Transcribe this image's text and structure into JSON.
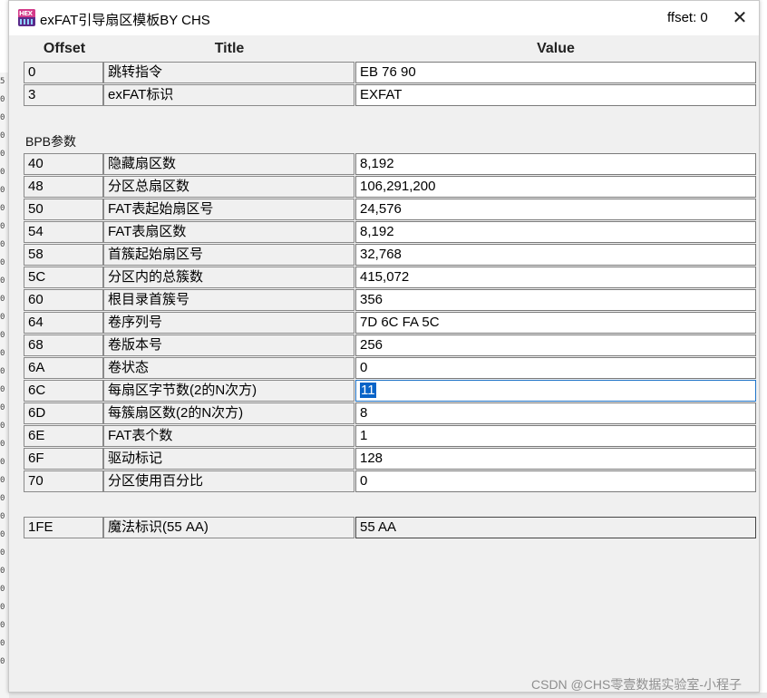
{
  "window": {
    "title": "exFAT引导扇区模板BY CHS",
    "offset_indicator": "ffset: 0",
    "close_glyph": "✕"
  },
  "columns": {
    "offset": "Offset",
    "title": "Title",
    "value": "Value"
  },
  "boot_rows": [
    {
      "offset": "0",
      "title": "跳转指令",
      "value": "EB 76 90"
    },
    {
      "offset": "3",
      "title": "exFAT标识",
      "value": "EXFAT"
    }
  ],
  "bpb_section_label": "BPB参数",
  "bpb_rows": [
    {
      "offset": "40",
      "title": "隐藏扇区数",
      "value": "8,192"
    },
    {
      "offset": "48",
      "title": "分区总扇区数",
      "value": "106,291,200"
    },
    {
      "offset": "50",
      "title": "FAT表起始扇区号",
      "value": "24,576"
    },
    {
      "offset": "54",
      "title": "FAT表扇区数",
      "value": "8,192"
    },
    {
      "offset": "58",
      "title": "首簇起始扇区号",
      "value": "32,768"
    },
    {
      "offset": "5C",
      "title": "分区内的总簇数",
      "value": "415,072"
    },
    {
      "offset": "60",
      "title": "根目录首簇号",
      "value": "356"
    },
    {
      "offset": "64",
      "title": "卷序列号",
      "value": "7D 6C FA 5C"
    },
    {
      "offset": "68",
      "title": "卷版本号",
      "value": "256"
    },
    {
      "offset": "6A",
      "title": "卷状态",
      "value": "0"
    },
    {
      "offset": "6C",
      "title": "每扇区字节数(2的N次方)",
      "value": "11",
      "selected": true
    },
    {
      "offset": "6D",
      "title": "每簇扇区数(2的N次方)",
      "value": "8"
    },
    {
      "offset": "6E",
      "title": "FAT表个数",
      "value": "1"
    },
    {
      "offset": "6F",
      "title": "驱动标记",
      "value": "128"
    },
    {
      "offset": "70",
      "title": "分区使用百分比",
      "value": "0"
    }
  ],
  "magic_row": {
    "offset": "1FE",
    "title": "魔法标识(55 AA)",
    "value": "55 AA"
  },
  "watermark": "CSDN @CHS零壹数据实验室-小程子",
  "background_glyphs": [
    "5",
    "0",
    "0",
    "0",
    "0",
    "0",
    "0",
    "0",
    "0",
    "0",
    "0",
    "0",
    "0",
    "0",
    "0",
    "0",
    "0",
    "0",
    "0",
    "0",
    "0",
    "0",
    "0",
    "0",
    "0",
    "0",
    "0",
    "0",
    "0",
    "0",
    "0",
    "0",
    "0"
  ],
  "colors": {
    "selection": "#0a64c8",
    "focus_border": "#1e73c8",
    "window_bg": "#f0f0f0"
  }
}
